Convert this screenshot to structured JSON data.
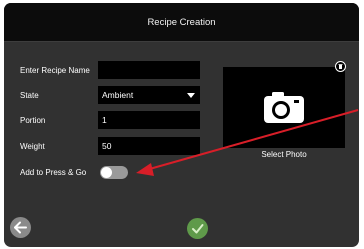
{
  "header": {
    "title": "Recipe Creation"
  },
  "form": {
    "recipe_name": {
      "label": "Enter Recipe Name",
      "value": ""
    },
    "state": {
      "label": "State",
      "value": "Ambient"
    },
    "portion": {
      "label": "Portion",
      "value": "1"
    },
    "weight": {
      "label": "Weight",
      "value": "50"
    },
    "press_go": {
      "label": "Add to Press & Go",
      "enabled": false
    }
  },
  "photo": {
    "label": "Select Photo"
  },
  "icons": {
    "camera": "camera-icon",
    "trash": "trash-icon",
    "back": "arrow-left-icon",
    "confirm": "checkmark-icon",
    "annotation": "red-arrow"
  },
  "colors": {
    "background": "#313131",
    "titlebar": "#0c0c0c",
    "field": "#000000",
    "confirm": "#5f9a4a",
    "annotation": "#d81e28"
  }
}
